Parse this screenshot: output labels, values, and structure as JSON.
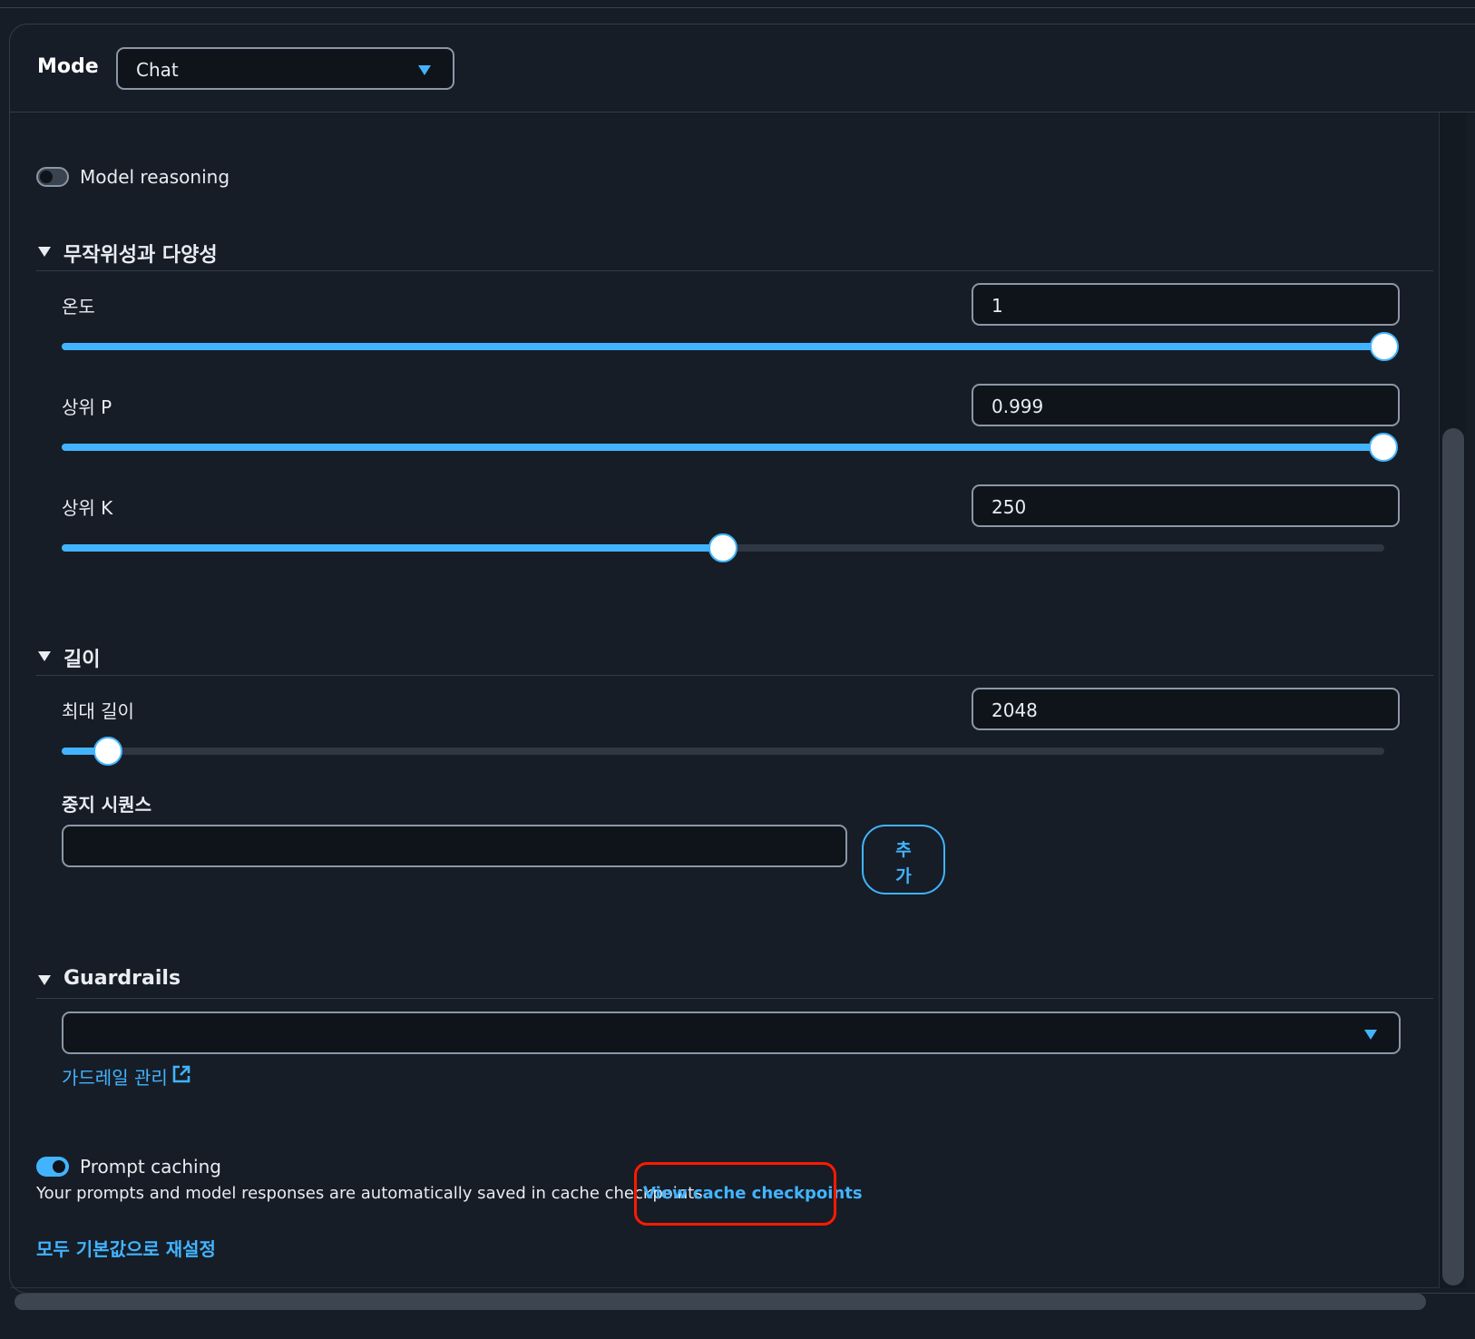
{
  "header": {
    "mode_label": "Mode",
    "mode_value": "Chat"
  },
  "reasoning": {
    "label": "Model reasoning",
    "enabled": false
  },
  "randomness": {
    "title": "무작위성과 다양성",
    "temperature": {
      "label": "온도",
      "value": "1",
      "fraction": 1.0
    },
    "top_p": {
      "label": "상위 P",
      "value": "0.999",
      "fraction": 0.999
    },
    "top_k": {
      "label": "상위 K",
      "value": "250",
      "fraction": 0.5
    }
  },
  "length": {
    "title": "길이",
    "max_length": {
      "label": "최대 길이",
      "value": "2048",
      "fraction": 0.035
    },
    "stop_sequences": {
      "label": "중지 시퀀스",
      "value": "",
      "add_label_line1": "추",
      "add_label_line2": "가"
    }
  },
  "guardrails": {
    "title": "Guardrails",
    "selected": "",
    "manage_link": "가드레일 관리"
  },
  "prompt_caching": {
    "label": "Prompt caching",
    "enabled": true,
    "description": "Your prompts and model responses are automatically saved in cache checkpoints",
    "view_link": "View cache checkpoints"
  },
  "reset_all": "모두 기본값으로 재설정",
  "colors": {
    "accent": "#42b4ff",
    "background": "#161d27",
    "highlight": "#ff1a00"
  },
  "icons": {
    "dropdown": "chevron-down-icon",
    "external": "external-link-icon",
    "section": "caret-down-icon"
  }
}
